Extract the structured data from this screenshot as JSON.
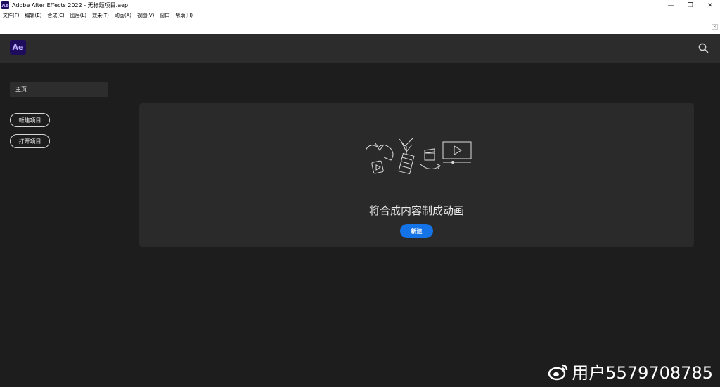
{
  "window": {
    "title": "Adobe After Effects 2022 - 无标题项目.aep",
    "app_icon_text": "Ae",
    "controls": {
      "minimize": "—",
      "restore": "❐",
      "close": "✕"
    }
  },
  "menu": [
    "文件(F)",
    "编辑(E)",
    "合成(C)",
    "图层(L)",
    "效果(T)",
    "动画(A)",
    "视图(V)",
    "窗口",
    "帮助(H)"
  ],
  "header": {
    "logo": "Ae",
    "search_icon": "search-icon"
  },
  "sidebar": {
    "home_label": "主页",
    "new_project_label": "新建项目",
    "open_project_label": "打开项目"
  },
  "main": {
    "headline": "将合成内容制成动画",
    "new_button_label": "新建"
  },
  "watermark": {
    "text": "用户5579708785",
    "icon": "weibo-icon"
  },
  "colors": {
    "accent": "#1473e6",
    "background": "#1d1d1d",
    "header": "#2c2c2c",
    "card": "#2a2a2a",
    "ae_brand": "#1e0d5c"
  }
}
